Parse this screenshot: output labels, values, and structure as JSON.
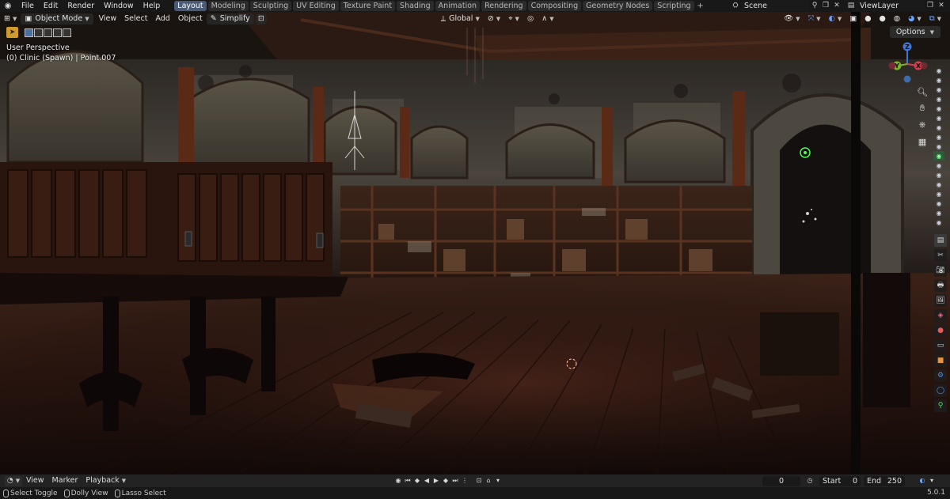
{
  "menu": {
    "items": [
      "File",
      "Edit",
      "Render",
      "Window",
      "Help"
    ]
  },
  "workspaces": {
    "tabs": [
      "Layout",
      "Modeling",
      "Sculpting",
      "UV Editing",
      "Texture Paint",
      "Shading",
      "Animation",
      "Rendering",
      "Compositing",
      "Geometry Nodes",
      "Scripting"
    ],
    "active": "Layout",
    "add_label": "+"
  },
  "top_right": {
    "scene_label": "Scene",
    "view_layer_label": "ViewLayer"
  },
  "viewport_header": {
    "mode": "Object Mode",
    "menus": [
      "View",
      "Select",
      "Add",
      "Object"
    ],
    "simplify": "Simplify",
    "transform_orientation": "Global"
  },
  "viewport": {
    "perspective": "User Perspective",
    "active_object": "(0) Clinic (Spawn) | Point.007",
    "options_label": "Options"
  },
  "gizmo": {
    "x_label": "X",
    "y_label": "Y",
    "z_label": "Z",
    "x_color": "#d93c4e",
    "y_color": "#7ab523",
    "z_color": "#3d78d6"
  },
  "timeline": {
    "menus": [
      "View",
      "Marker",
      "Playback"
    ],
    "current_frame": "0",
    "start_label": "Start",
    "start_value": "0",
    "end_label": "End",
    "end_value": "250"
  },
  "statusbar": {
    "items": [
      "Select Toggle",
      "Dolly View",
      "Lasso Select"
    ],
    "version": "5.0.1"
  },
  "colors": {
    "accent": "#4a5a75",
    "active_tool": "#d09a2e"
  }
}
